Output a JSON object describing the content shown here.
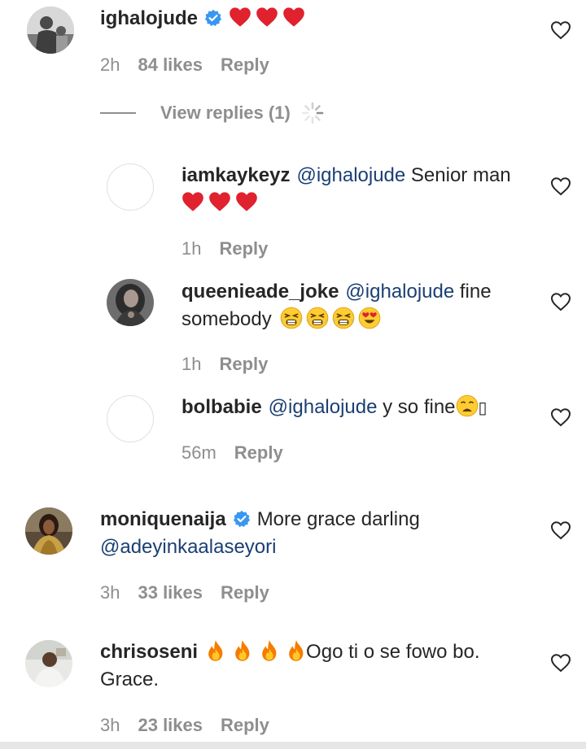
{
  "comments": [
    {
      "username": "ighalojude",
      "verified": true,
      "text": "",
      "time": "2h",
      "likes": "84 likes",
      "reply_label": "Reply",
      "view_replies": "View replies (1)"
    },
    {
      "username": "iamkaykeyz",
      "mention": "@ighalojude",
      "text": "Senior man",
      "time": "1h",
      "reply_label": "Reply"
    },
    {
      "username": "queenieade_joke",
      "mention": "@ighalojude",
      "text": "fine",
      "text2": "somebody",
      "time": "1h",
      "reply_label": "Reply"
    },
    {
      "username": "bolbabie",
      "mention": "@ighalojude",
      "text": "y so fine",
      "tail": "▯",
      "time": "56m",
      "reply_label": "Reply"
    },
    {
      "username": "moniquenaija",
      "verified": true,
      "text": "More grace darling",
      "mention": "@adeyinkaalaseyori",
      "time": "3h",
      "likes": "33 likes",
      "reply_label": "Reply"
    },
    {
      "username": "chrisoseni",
      "text": "Ogo ti o se fowo bo.",
      "text2": "Grace.",
      "time": "3h",
      "likes": "23 likes",
      "reply_label": "Reply"
    }
  ],
  "colors": {
    "heart_red": "#e0212e",
    "mention_blue": "#1b3f74",
    "verified_blue": "#3897f0",
    "meta_gray": "#8e8e8e"
  }
}
